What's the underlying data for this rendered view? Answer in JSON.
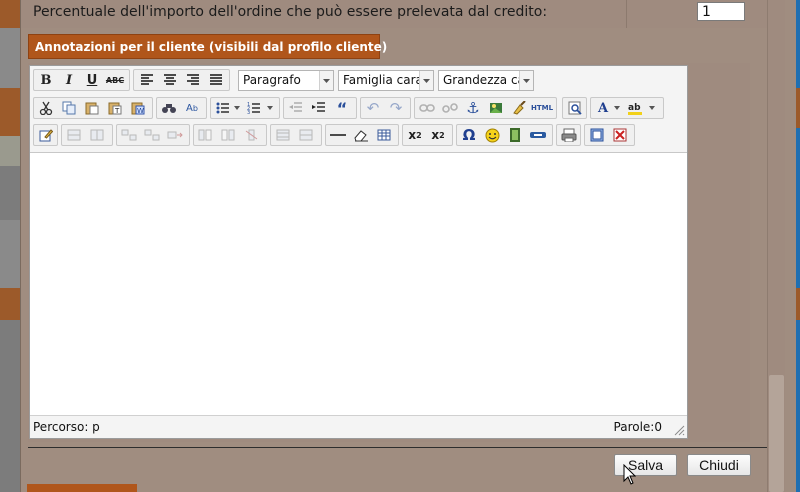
{
  "credit": {
    "label": "Percentuale dell'importo dell'ordine che può essere prelevata dal credito:",
    "value": "1"
  },
  "notes_section": {
    "title": "Annotazioni per il cliente (visibili dal profilo cliente)"
  },
  "editor": {
    "format_combo": "Paragrafo",
    "font_family_combo": "Famiglia caratt",
    "font_size_combo": "Grandezza car",
    "status_path": "Percorso: p",
    "word_count": "Parole:0",
    "toolbar_icons": {
      "row1": [
        "bold-icon",
        "italic-icon",
        "underline-icon",
        "strikethrough-icon",
        "align-left-icon",
        "align-center-icon",
        "align-right-icon",
        "align-justify-icon"
      ],
      "row2": [
        "cut-icon",
        "copy-icon",
        "paste-icon",
        "paste-text-icon",
        "paste-word-icon",
        "find-icon",
        "replace-icon",
        "bullet-list-icon",
        "numbered-list-icon",
        "outdent-icon",
        "indent-icon",
        "blockquote-icon",
        "undo-icon",
        "redo-icon",
        "link-icon",
        "unlink-icon",
        "anchor-icon",
        "image-icon",
        "cleanup-icon",
        "html-icon",
        "preview-icon",
        "text-color-icon",
        "highlight-color-icon"
      ],
      "row3": [
        "edit-icon",
        "table-row-icon",
        "table-col-icon",
        "table-insert-icon",
        "table-split-icon",
        "table-merge-icon",
        "horizontal-rule-icon",
        "eraser-icon",
        "table-icon",
        "subscript-icon",
        "superscript-icon",
        "omega-icon",
        "smiley-icon",
        "media-icon",
        "minus-bar-icon",
        "print-icon",
        "fullscreen-icon",
        "remove-format-icon"
      ]
    }
  },
  "buttons": {
    "save": "Salva",
    "close": "Chiudi"
  },
  "colors": {
    "dialog_bg": "#a08d80",
    "section_tab": "#b0561b",
    "bg_page": "#6f6f6f"
  }
}
